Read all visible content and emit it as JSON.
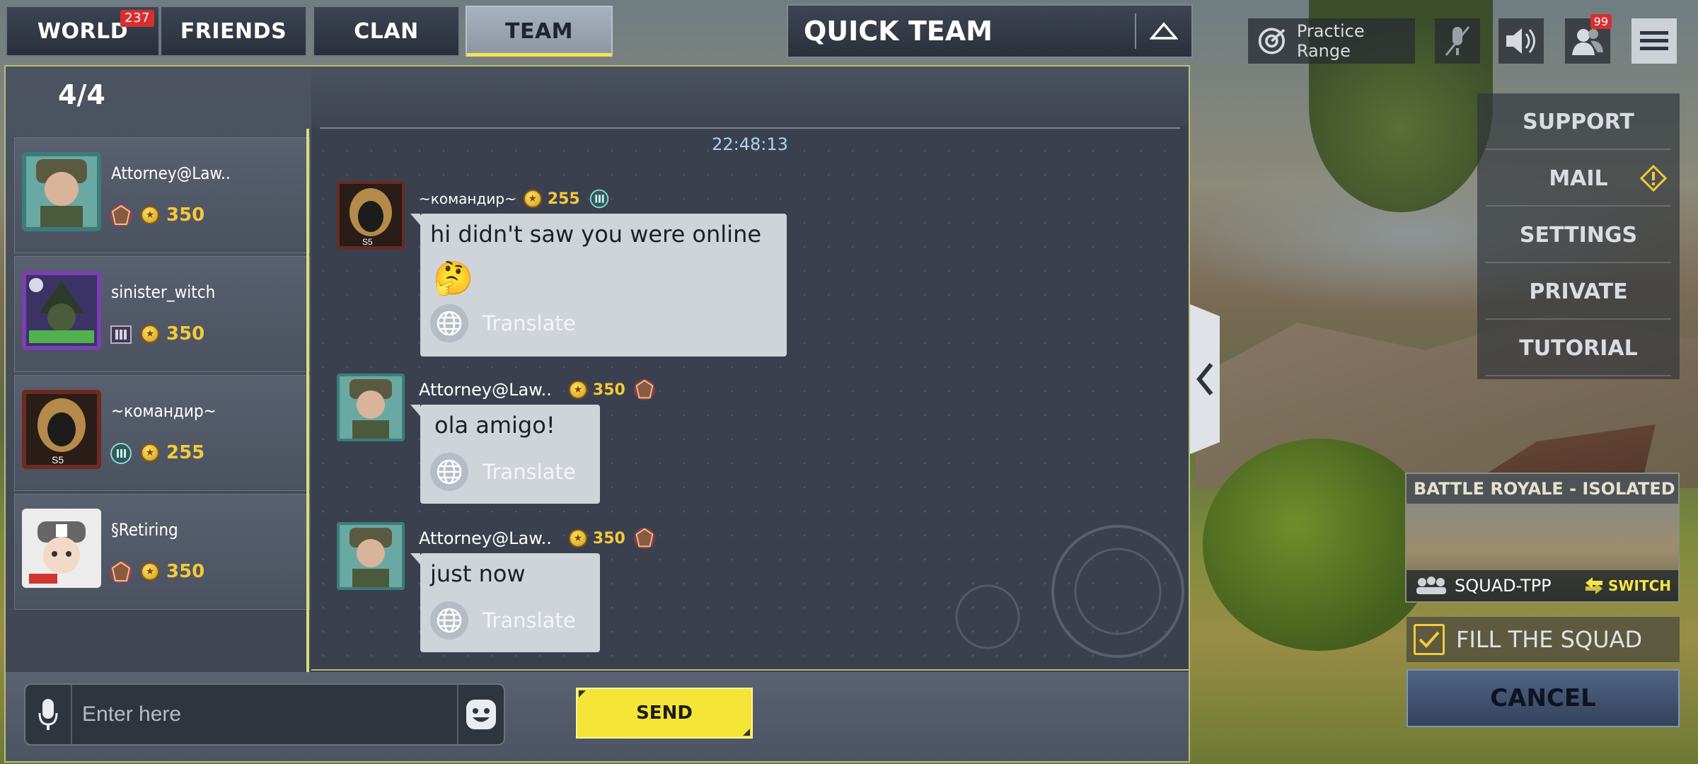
{
  "tabs": [
    {
      "label": "WORLD",
      "badge": "237",
      "active": false
    },
    {
      "label": "FRIENDS",
      "badge": "",
      "active": false
    },
    {
      "label": "CLAN",
      "badge": "",
      "active": false
    },
    {
      "label": "TEAM",
      "badge": "",
      "active": true
    }
  ],
  "quick_team": {
    "label": "QUICK TEAM"
  },
  "roster": {
    "count": "4/4",
    "members": [
      {
        "name": "Attorney@Law..",
        "points": "350"
      },
      {
        "name": "sinister_witch",
        "points": "350"
      },
      {
        "name": "~командир~",
        "points": "255"
      },
      {
        "name": "§Retiring",
        "points": "350"
      }
    ]
  },
  "chat": {
    "timestamp": "22:48:13",
    "translate_label": "Translate",
    "messages": [
      {
        "sender": "~командир~",
        "points": "255",
        "text": "hi didn't saw you were online",
        "emoji": "🤔"
      },
      {
        "sender": "Attorney@Law..",
        "points": "350",
        "text": "ola amigo!"
      },
      {
        "sender": "Attorney@Law..",
        "points": "350",
        "text": "just now"
      }
    ]
  },
  "input": {
    "placeholder": "Enter here",
    "value": "",
    "send_label": "SEND"
  },
  "hud": {
    "practice_range": "Practice Range",
    "friends_badge": "99",
    "menu": [
      "SUPPORT",
      "MAIL",
      "SETTINGS",
      "PRIVATE",
      "TUTORIAL"
    ]
  },
  "mode": {
    "title": "BATTLE ROYALE - ISOLATED",
    "squad": "SQUAD-TPP",
    "switch": "SWITCH"
  },
  "fill_squad": {
    "label": "FILL THE SQUAD",
    "checked": true
  },
  "cancel": {
    "label": "CANCEL"
  },
  "colors": {
    "accent": "#f4e536",
    "badge": "#d92e2e",
    "points": "#f5c93a",
    "timestamp": "#a9d4f5"
  }
}
